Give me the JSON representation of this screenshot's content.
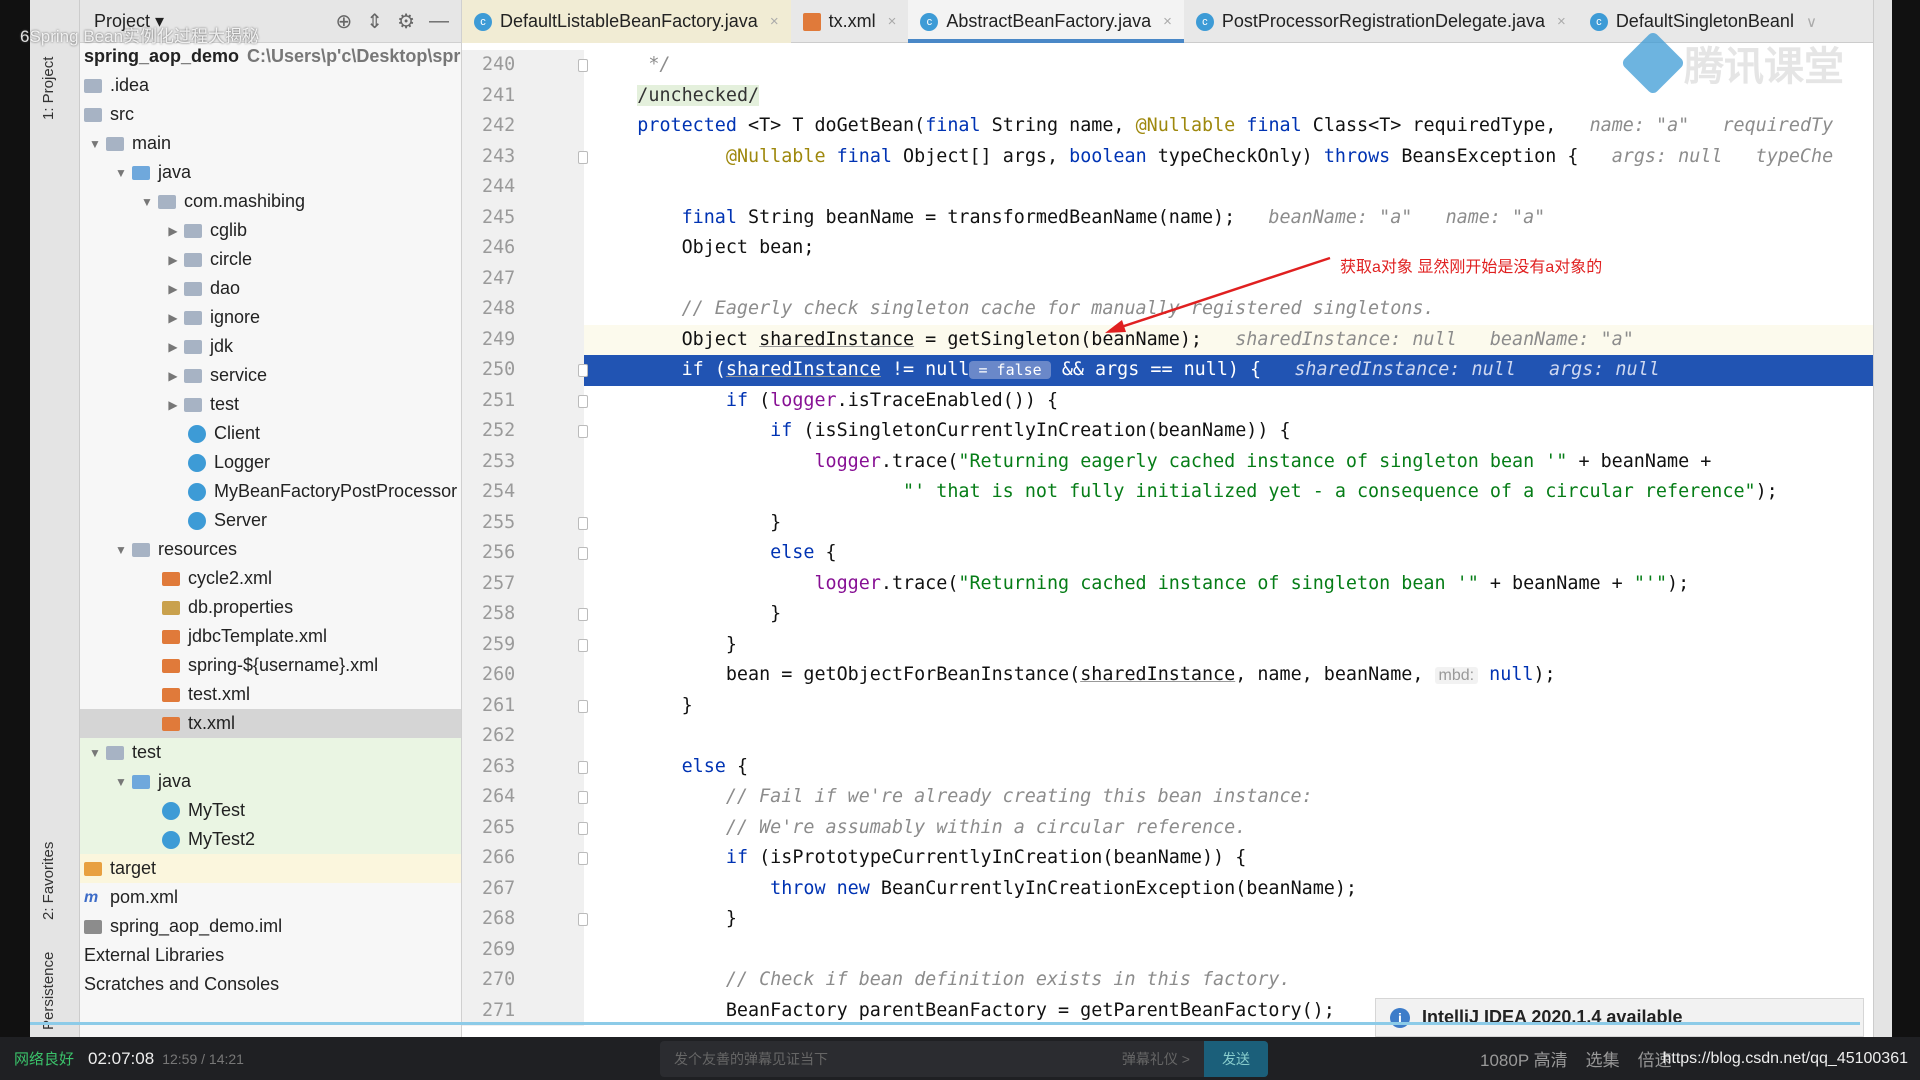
{
  "overlay": {
    "video_title": "6Spring Bean实例化过程大揭秘",
    "logo_text": "腾讯课堂",
    "annotation": "获取a对象   显然刚开始是没有a对象的",
    "annotation_color": "#e02020"
  },
  "tool_strip": {
    "project": "1: Project",
    "favorites": "2: Favorites",
    "persistence": "Persistence"
  },
  "project_panel": {
    "title": "Project",
    "rows": [
      {
        "label": "spring_aop_demo",
        "path": "C:\\Users\\p'c\\Desktop\\spri",
        "level": 0,
        "icon": "none",
        "root": true
      },
      {
        "label": ".idea",
        "level": 0,
        "icon": "folder"
      },
      {
        "label": "src",
        "level": 0,
        "icon": "folder"
      },
      {
        "label": "main",
        "level": 0,
        "icon": "folder",
        "arrow": "open"
      },
      {
        "label": "java",
        "level": 1,
        "icon": "folder-java",
        "arrow": "open"
      },
      {
        "label": "com.mashibing",
        "level": 2,
        "icon": "folder",
        "arrow": "open"
      },
      {
        "label": "cglib",
        "level": 3,
        "icon": "folder",
        "arrow": "closed"
      },
      {
        "label": "circle",
        "level": 3,
        "icon": "folder",
        "arrow": "closed"
      },
      {
        "label": "dao",
        "level": 3,
        "icon": "folder",
        "arrow": "closed"
      },
      {
        "label": "ignore",
        "level": 3,
        "icon": "folder",
        "arrow": "closed"
      },
      {
        "label": "jdk",
        "level": 3,
        "icon": "folder",
        "arrow": "closed"
      },
      {
        "label": "service",
        "level": 3,
        "icon": "folder",
        "arrow": "closed"
      },
      {
        "label": "test",
        "level": 3,
        "icon": "folder",
        "arrow": "closed"
      },
      {
        "label": "Client",
        "level": 4,
        "icon": "class"
      },
      {
        "label": "Logger",
        "level": 4,
        "icon": "class"
      },
      {
        "label": "MyBeanFactoryPostProcessor",
        "level": 4,
        "icon": "class"
      },
      {
        "label": "Server",
        "level": 4,
        "icon": "class"
      },
      {
        "label": "resources",
        "level": 1,
        "icon": "folder",
        "arrow": "open"
      },
      {
        "label": "cycle2.xml",
        "level": 3,
        "icon": "xml"
      },
      {
        "label": "db.properties",
        "level": 3,
        "icon": "props"
      },
      {
        "label": "jdbcTemplate.xml",
        "level": 3,
        "icon": "xml"
      },
      {
        "label": "spring-${username}.xml",
        "level": 3,
        "icon": "xml"
      },
      {
        "label": "test.xml",
        "level": 3,
        "icon": "xml"
      },
      {
        "label": "tx.xml",
        "level": 3,
        "icon": "xml",
        "selected": true
      },
      {
        "label": "test",
        "level": 0,
        "icon": "folder",
        "arrow": "open",
        "tint": "green"
      },
      {
        "label": "java",
        "level": 1,
        "icon": "folder-java",
        "arrow": "open",
        "tint": "green"
      },
      {
        "label": "MyTest",
        "level": 3,
        "icon": "class",
        "tint": "green"
      },
      {
        "label": "MyTest2",
        "level": 3,
        "icon": "class",
        "tint": "green"
      },
      {
        "label": "target",
        "level": 0,
        "icon": "folder-orange",
        "tint": "yellow"
      },
      {
        "label": "pom.xml",
        "level": 0,
        "icon": "pom"
      },
      {
        "label": "spring_aop_demo.iml",
        "level": 0,
        "icon": "iml"
      },
      {
        "label": "External Libraries",
        "level": 0,
        "icon": "none"
      },
      {
        "label": "Scratches and Consoles",
        "level": 0,
        "icon": "none"
      }
    ]
  },
  "tabs": [
    {
      "label": "DefaultListableBeanFactory.java",
      "type": "class",
      "pinned": true
    },
    {
      "label": "tx.xml",
      "type": "xml"
    },
    {
      "label": "AbstractBeanFactory.java",
      "type": "class",
      "active": true
    },
    {
      "label": "PostProcessorRegistrationDelegate.java",
      "type": "class"
    },
    {
      "label": "DefaultSingletonBeanl",
      "type": "class",
      "overflow": true
    }
  ],
  "editor": {
    "lines": [
      {
        "n": "240",
        "fold": true,
        "t": [
          [
            "     */",
            "cmt"
          ]
        ]
      },
      {
        "n": "241",
        "t": [
          [
            "    ",
            ""
          ],
          [
            "/unchecked/",
            "supp"
          ]
        ]
      },
      {
        "n": "242",
        "t": [
          [
            "    ",
            ""
          ],
          [
            "protected",
            "kw"
          ],
          [
            " <T> T doGetBean(",
            ""
          ],
          [
            "final",
            "kw"
          ],
          [
            " String name, ",
            ""
          ],
          [
            "@Nullable",
            "ann"
          ],
          [
            " ",
            ""
          ],
          [
            "final",
            "kw"
          ],
          [
            " Class<T> requiredType,",
            ""
          ],
          [
            "   name: \"a\"   requiredTy",
            "hint"
          ]
        ]
      },
      {
        "n": "243",
        "fold": true,
        "t": [
          [
            "            ",
            ""
          ],
          [
            "@Nullable",
            "ann"
          ],
          [
            " ",
            ""
          ],
          [
            "final",
            "kw"
          ],
          [
            " Object[] args, ",
            ""
          ],
          [
            "boolean",
            "kw"
          ],
          [
            " typeCheckOnly) ",
            ""
          ],
          [
            "throws",
            "kw"
          ],
          [
            " BeansException {",
            ""
          ],
          [
            "   args: null   typeChe",
            "hint"
          ]
        ]
      },
      {
        "n": "244",
        "t": []
      },
      {
        "n": "245",
        "t": [
          [
            "        ",
            ""
          ],
          [
            "final",
            "kw"
          ],
          [
            " String beanName = transformedBeanName(name);",
            ""
          ],
          [
            "   beanName: \"a\"   name: \"a\"",
            "hint"
          ]
        ]
      },
      {
        "n": "246",
        "t": [
          [
            "        Object bean;",
            ""
          ]
        ]
      },
      {
        "n": "247",
        "t": []
      },
      {
        "n": "248",
        "t": [
          [
            "        // Eagerly check singleton cache for manually registered singletons.",
            "cmt"
          ]
        ]
      },
      {
        "n": "249",
        "current": true,
        "t": [
          [
            "        Object ",
            ""
          ],
          [
            "sharedInstance",
            "und"
          ],
          [
            " = getSingleton(beanName);",
            ""
          ],
          [
            "   sharedInstance: null   beanName: \"a\"",
            "hint"
          ]
        ]
      },
      {
        "n": "250",
        "exec": true,
        "fold": true,
        "t": [
          [
            "        if (",
            ""
          ],
          [
            "sharedInstance",
            "und"
          ],
          [
            " != null",
            ""
          ],
          [
            " = false ",
            "chip"
          ],
          [
            " && args == null) {",
            ""
          ],
          [
            "   sharedInstance: null   args: null",
            "hint"
          ]
        ]
      },
      {
        "n": "251",
        "fold": true,
        "t": [
          [
            "            ",
            ""
          ],
          [
            "if",
            "kw"
          ],
          [
            " (",
            ""
          ],
          [
            "logger",
            "fld"
          ],
          [
            ".isTraceEnabled()) {",
            ""
          ]
        ]
      },
      {
        "n": "252",
        "fold": true,
        "t": [
          [
            "                ",
            ""
          ],
          [
            "if",
            "kw"
          ],
          [
            " (isSingletonCurrentlyInCreation(beanName)) {",
            ""
          ]
        ]
      },
      {
        "n": "253",
        "t": [
          [
            "                    ",
            ""
          ],
          [
            "logger",
            "fld"
          ],
          [
            ".trace(",
            ""
          ],
          [
            "\"Returning eagerly cached instance of singleton bean '\"",
            "str"
          ],
          [
            " + beanName +",
            ""
          ]
        ]
      },
      {
        "n": "254",
        "t": [
          [
            "                            ",
            ""
          ],
          [
            "\"' that is not fully initialized yet - a consequence of a circular reference\"",
            "str"
          ],
          [
            ");",
            ""
          ]
        ]
      },
      {
        "n": "255",
        "fold": true,
        "t": [
          [
            "                }",
            ""
          ]
        ]
      },
      {
        "n": "256",
        "fold": true,
        "t": [
          [
            "                ",
            ""
          ],
          [
            "else",
            "kw"
          ],
          [
            " {",
            ""
          ]
        ]
      },
      {
        "n": "257",
        "t": [
          [
            "                    ",
            ""
          ],
          [
            "logger",
            "fld"
          ],
          [
            ".trace(",
            ""
          ],
          [
            "\"Returning cached instance of singleton bean '\"",
            "str"
          ],
          [
            " + beanName + ",
            ""
          ],
          [
            "\"'\"",
            "str"
          ],
          [
            ");",
            ""
          ]
        ]
      },
      {
        "n": "258",
        "fold": true,
        "t": [
          [
            "                }",
            ""
          ]
        ]
      },
      {
        "n": "259",
        "fold": true,
        "t": [
          [
            "            }",
            ""
          ]
        ]
      },
      {
        "n": "260",
        "t": [
          [
            "            bean = getObjectForBeanInstance(",
            ""
          ],
          [
            "sharedInstance",
            "und"
          ],
          [
            ", name, beanName, ",
            ""
          ],
          [
            "mbd:",
            "phint"
          ],
          [
            " ",
            ""
          ],
          [
            "null",
            "kw"
          ],
          [
            ");",
            ""
          ]
        ]
      },
      {
        "n": "261",
        "fold": true,
        "t": [
          [
            "        }",
            ""
          ]
        ]
      },
      {
        "n": "262",
        "t": []
      },
      {
        "n": "263",
        "fold": true,
        "t": [
          [
            "        ",
            ""
          ],
          [
            "else",
            "kw"
          ],
          [
            " {",
            ""
          ]
        ]
      },
      {
        "n": "264",
        "fold": true,
        "t": [
          [
            "            // Fail if we're already creating this bean instance:",
            "cmt"
          ]
        ]
      },
      {
        "n": "265",
        "fold": true,
        "t": [
          [
            "            // We're assumably within a circular reference.",
            "cmt"
          ]
        ]
      },
      {
        "n": "266",
        "fold": true,
        "t": [
          [
            "            ",
            ""
          ],
          [
            "if",
            "kw"
          ],
          [
            " (isPrototypeCurrentlyInCreation(beanName)) {",
            ""
          ]
        ]
      },
      {
        "n": "267",
        "t": [
          [
            "                ",
            ""
          ],
          [
            "throw",
            "kw"
          ],
          [
            " ",
            ""
          ],
          [
            "new",
            "kw"
          ],
          [
            " BeanCurrentlyInCreationException(beanName);",
            ""
          ]
        ]
      },
      {
        "n": "268",
        "fold": true,
        "t": [
          [
            "            }",
            ""
          ]
        ]
      },
      {
        "n": "269",
        "t": []
      },
      {
        "n": "270",
        "t": [
          [
            "            // Check if bean definition exists in this factory.",
            "cmt"
          ]
        ]
      },
      {
        "n": "271",
        "t": [
          [
            "            BeanFactory parentBeanFactory = getParentBeanFactory();",
            ""
          ]
        ]
      }
    ]
  },
  "notification": {
    "text": "IntelliJ IDEA 2020.1.4 available"
  },
  "player": {
    "network": "网络良好",
    "current_time": "02:07:08",
    "duration": "12:59 / 14:21",
    "danmaku_placeholder": "发个友善的弹幕见证当下",
    "etiquette": "弹幕礼仪 >",
    "send": "发送",
    "quality": "1080P 高清",
    "episodes": "选集",
    "speed": "倍速",
    "url": "https://blog.csdn.net/qq_45100361"
  },
  "colors": {
    "exec_line": "#2154b3",
    "active_tab_underline": "#4a88c7",
    "keyword": "#0033b3",
    "string": "#067d17"
  }
}
